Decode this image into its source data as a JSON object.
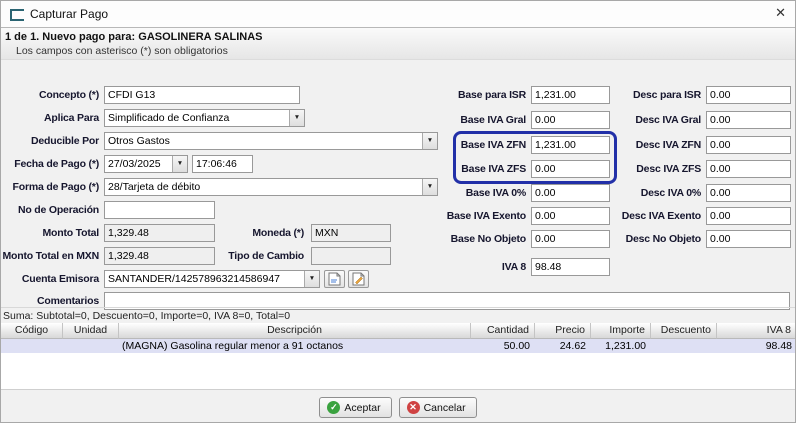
{
  "window": {
    "title": "Capturar Pago"
  },
  "icons": {
    "dropdown_arrow": "▼",
    "close": "✕",
    "check": "✓",
    "cross": "✕"
  },
  "header": {
    "title_line": "1 de 1. Nuevo pago para: GASOLINERA SALINAS",
    "subtitle_line": "Los campos con asterisco (*) son obligatorios"
  },
  "form": {
    "concepto": {
      "label": "Concepto (*)",
      "value": "CFDI G13"
    },
    "aplica_para": {
      "label": "Aplica Para",
      "value": "Simplificado de Confianza"
    },
    "deducible_por": {
      "label": "Deducible Por",
      "value": "Otros Gastos"
    },
    "fecha_pago": {
      "label": "Fecha de Pago (*)",
      "date": "27/03/2025",
      "time": "17:06:46"
    },
    "forma_pago": {
      "label": "Forma de Pago (*)",
      "value": "28/Tarjeta de débito"
    },
    "no_operacion": {
      "label": "No de Operación",
      "value": ""
    },
    "monto_total": {
      "label": "Monto Total",
      "value": "1,329.48"
    },
    "moneda": {
      "label": "Moneda (*)",
      "value": "MXN"
    },
    "monto_total_mxn": {
      "label": "Monto Total en MXN",
      "value": "1,329.48"
    },
    "tipo_cambio": {
      "label": "Tipo de Cambio",
      "value": ""
    },
    "cuenta_emisora": {
      "label": "Cuenta Emisora",
      "value": "SANTANDER/142578963214586947"
    },
    "comentarios": {
      "label": "Comentarios",
      "value": ""
    }
  },
  "amounts": {
    "base_para_isr": {
      "label": "Base para ISR",
      "value": "1,231.00"
    },
    "base_iva_gral": {
      "label": "Base IVA Gral",
      "value": "0.00"
    },
    "base_iva_zfn": {
      "label": "Base IVA ZFN",
      "value": "1,231.00"
    },
    "base_iva_zfs": {
      "label": "Base IVA ZFS",
      "value": "0.00"
    },
    "base_iva_0": {
      "label": "Base IVA 0%",
      "value": "0.00"
    },
    "base_iva_exento": {
      "label": "Base IVA Exento",
      "value": "0.00"
    },
    "base_no_objeto": {
      "label": "Base No Objeto",
      "value": "0.00"
    },
    "iva_8": {
      "label": "IVA 8",
      "value": "98.48"
    },
    "desc_para_isr": {
      "label": "Desc para ISR",
      "value": "0.00"
    },
    "desc_iva_gral": {
      "label": "Desc IVA Gral",
      "value": "0.00"
    },
    "desc_iva_zfn": {
      "label": "Desc IVA ZFN",
      "value": "0.00"
    },
    "desc_iva_zfs": {
      "label": "Desc IVA ZFS",
      "value": "0.00"
    },
    "desc_iva_0": {
      "label": "Desc IVA 0%",
      "value": "0.00"
    },
    "desc_iva_exento": {
      "label": "Desc IVA Exento",
      "value": "0.00"
    },
    "desc_no_objeto": {
      "label": "Desc No Objeto",
      "value": "0.00"
    }
  },
  "summary": {
    "text": "Suma: Subtotal=0, Descuento=0, Importe=0, IVA 8=0, Total=0"
  },
  "table": {
    "headers": [
      "Código",
      "Unidad",
      "Descripción",
      "Cantidad",
      "Precio",
      "Importe",
      "Descuento",
      "IVA 8"
    ],
    "rows": [
      {
        "codigo": "",
        "unidad": "",
        "descripcion": "(MAGNA) Gasolina regular menor a 91 octanos",
        "cantidad": "50.00",
        "precio": "24.62",
        "importe": "1,231.00",
        "descuento": "",
        "iva8": "98.48"
      }
    ]
  },
  "buttons": {
    "aceptar": "Aceptar",
    "cancelar": "Cancelar"
  },
  "colors": {
    "highlight_border": "#2230a8",
    "row_highlight_bg": "#dee0f4",
    "accept_green": "#3aa23f",
    "cancel_red": "#cf4242"
  }
}
